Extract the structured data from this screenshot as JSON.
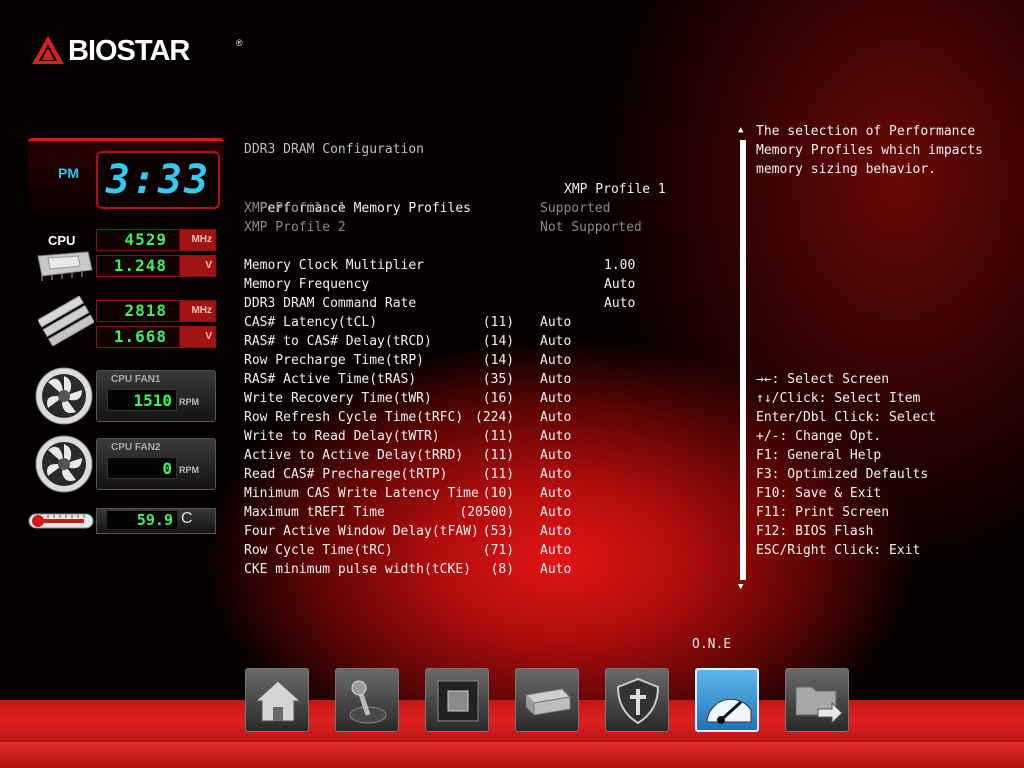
{
  "brand": {
    "logo_text": "BIOSTAR",
    "reg": "®"
  },
  "monitor": {
    "ampm": "PM",
    "clock": "3:33",
    "cpu_label": "CPU",
    "cpu_freq": "4529",
    "cpu_freq_unit": "MHz",
    "cpu_volt": "1.248",
    "cpu_volt_unit": "V",
    "mem_freq": "2818",
    "mem_freq_unit": "MHz",
    "mem_volt": "1.668",
    "mem_volt_unit": "V",
    "fan1_label": "CPU FAN1",
    "fan1_rpm": "1510",
    "fan1_unit": "RPM",
    "fan2_label": "CPU FAN2",
    "fan2_rpm": "0",
    "fan2_unit": "RPM",
    "temp": "59.9",
    "temp_unit": "C"
  },
  "page": {
    "section_title": "DDR3 DRAM Configuration",
    "profile": {
      "label": "Performance Memory Profiles",
      "value": "XMP Profile 1"
    },
    "xmp_rows": [
      {
        "label": "XMP Profile 1",
        "value": "Supported"
      },
      {
        "label": "XMP Profile 2",
        "value": "Not Supported"
      }
    ],
    "clock_rows": [
      {
        "label": "Memory Clock Multiplier",
        "value": "1.00"
      },
      {
        "label": "Memory Frequency",
        "value": "Auto"
      },
      {
        "label": "DDR3 DRAM Command Rate",
        "value": "Auto"
      }
    ],
    "timing_rows": [
      {
        "label": "CAS# Latency(tCL)",
        "current": "(11)",
        "value": "Auto"
      },
      {
        "label": "RAS# to CAS# Delay(tRCD)",
        "current": "(14)",
        "value": "Auto"
      },
      {
        "label": "Row Precharge Time(tRP)",
        "current": "(14)",
        "value": "Auto"
      },
      {
        "label": "RAS# Active Time(tRAS)",
        "current": "(35)",
        "value": "Auto"
      },
      {
        "label": "Write Recovery Time(tWR)",
        "current": "(16)",
        "value": "Auto"
      },
      {
        "label": "Row Refresh Cycle Time(tRFC)",
        "current": "(224)",
        "value": "Auto"
      },
      {
        "label": "Write to Read Delay(tWTR)",
        "current": "(11)",
        "value": "Auto"
      },
      {
        "label": "Active to Active Delay(tRRD)",
        "current": "(11)",
        "value": "Auto"
      },
      {
        "label": "Read CAS# Precharege(tRTP)",
        "current": "(11)",
        "value": "Auto"
      },
      {
        "label": "Minimum CAS Write Latency Time",
        "current": "(10)",
        "value": "Auto"
      },
      {
        "label": "Maximum tREFI Time",
        "current": "(20500)",
        "value": "Auto"
      },
      {
        "label": "Four Active Window Delay(tFAW)",
        "current": "(53)",
        "value": "Auto"
      },
      {
        "label": "Row Cycle Time(tRC)",
        "current": "(71)",
        "value": "Auto"
      },
      {
        "label": "CKE minimum pulse width(tCKE)",
        "current": "(8)",
        "value": "Auto"
      }
    ]
  },
  "scroll": {
    "up": "▲",
    "down": "▼"
  },
  "help": {
    "text": "The selection of Performance Memory Profiles which impacts memory sizing behavior."
  },
  "keys": [
    "→←: Select Screen",
    "↑↓/Click: Select Item",
    "Enter/Dbl Click: Select",
    "+/-: Change Opt.",
    "F1: General Help",
    "F3: Optimized Defaults",
    "F10: Save & Exit",
    "F11: Print Screen",
    "F12: BIOS Flash",
    "ESC/Right Click: Exit"
  ],
  "nav": {
    "active_label": "O.N.E",
    "buttons": [
      {
        "name": "home",
        "icon": "home-icon"
      },
      {
        "name": "advanced",
        "icon": "joystick-icon"
      },
      {
        "name": "chipset",
        "icon": "chip-icon"
      },
      {
        "name": "boot",
        "icon": "drive-icon"
      },
      {
        "name": "security",
        "icon": "shield-icon"
      },
      {
        "name": "one",
        "icon": "speedometer-icon",
        "active": true
      },
      {
        "name": "save-exit",
        "icon": "folder-exit-icon"
      }
    ]
  },
  "colors": {
    "accent": "#d01818",
    "lcd": "#3cf25a",
    "clock": "#35c8f2",
    "active_tab": "#3a96d8"
  }
}
